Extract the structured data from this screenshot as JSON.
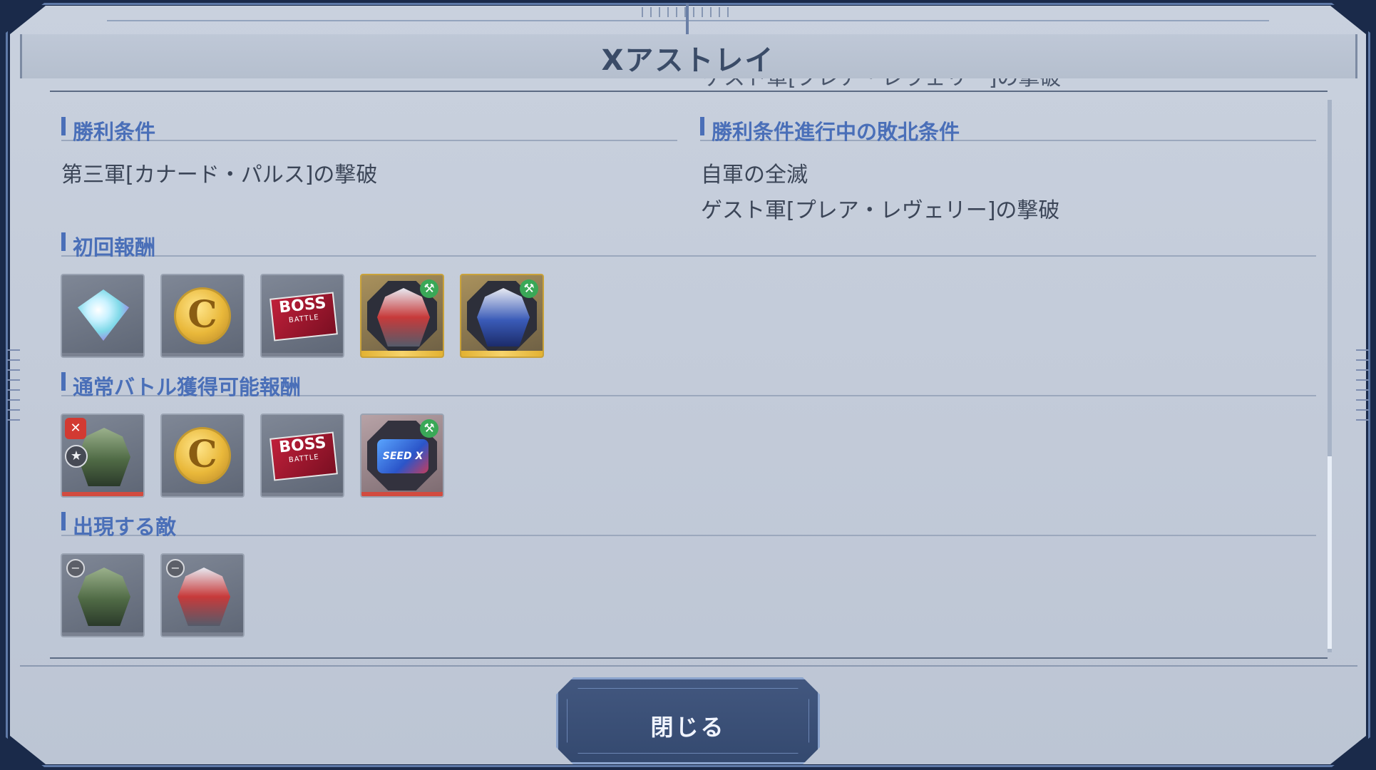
{
  "dialog": {
    "title": "Xアストレイ",
    "scrolled_partial_text": "ゲスト軍[プレア・レヴェリー]の撃破"
  },
  "victory": {
    "heading": "勝利条件",
    "conditions": [
      "第三軍[カナード・パルス]の撃破"
    ]
  },
  "defeat": {
    "heading": "勝利条件進行中の敗北条件",
    "conditions": [
      "自軍の全滅",
      "ゲスト軍[プレア・レヴェリー]の撃破"
    ]
  },
  "first_reward": {
    "heading": "初回報酬",
    "items": [
      {
        "icon": "diamond-icon",
        "rarity": "gray"
      },
      {
        "icon": "capital-coin-icon",
        "text": "C",
        "rarity": "gray"
      },
      {
        "icon": "boss-battle-ticket-icon",
        "text_main": "BOSS",
        "text_sub": "BATTLE",
        "rarity": "gray"
      },
      {
        "icon": "mobile-suit-blueprint-icon",
        "variant": "red",
        "rarity": "gold"
      },
      {
        "icon": "mobile-suit-blueprint-icon",
        "variant": "blue",
        "rarity": "gold"
      }
    ]
  },
  "normal_reward": {
    "heading": "通常バトル獲得可能報酬",
    "items": [
      {
        "icon": "unit-icon",
        "variant": "green",
        "rarity": "red"
      },
      {
        "icon": "capital-coin-icon",
        "text": "C",
        "rarity": "gray"
      },
      {
        "icon": "boss-battle-ticket-icon",
        "text_main": "BOSS",
        "text_sub": "BATTLE",
        "rarity": "gray"
      },
      {
        "icon": "seed-series-blueprint-icon",
        "text": "SEED X",
        "rarity": "red"
      }
    ]
  },
  "enemies": {
    "heading": "出現する敵",
    "items": [
      {
        "icon": "enemy-unit-icon",
        "variant": "green"
      },
      {
        "icon": "enemy-unit-icon",
        "variant": "red"
      }
    ]
  },
  "buttons": {
    "close_label": "閉じる"
  },
  "colors": {
    "heading_accent": "#4a6fb8",
    "panel_bg": "#c3cbd9",
    "button_bg": "#3d5279",
    "gold_frame": "#e3b232",
    "red_frame": "#d24b3f"
  }
}
